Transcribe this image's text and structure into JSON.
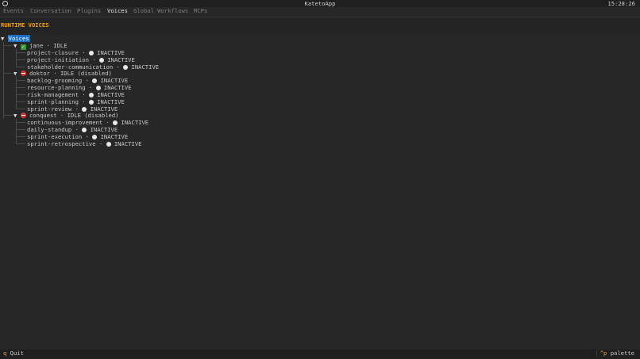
{
  "app": {
    "title": "KatetoApp",
    "clock": "15:28:26"
  },
  "tabs": [
    {
      "label": "Events"
    },
    {
      "label": "Conversation"
    },
    {
      "label": "Plugins"
    },
    {
      "label": "Voices"
    },
    {
      "label": "Global Workflows"
    },
    {
      "label": "MCPs"
    }
  ],
  "active_tab": "Voices",
  "section": {
    "title": "RUNTIME VOICES"
  },
  "tree": {
    "caret": "▼",
    "root": "Voices",
    "separator": " · ",
    "voices": [
      {
        "name": "jane",
        "status": "IDLE",
        "status_icon": "check-icon",
        "workflows": [
          {
            "name": "project-closure",
            "state": "INACTIVE"
          },
          {
            "name": "project-initiation",
            "state": "INACTIVE"
          },
          {
            "name": "stakeholder-communication",
            "state": "INACTIVE"
          }
        ]
      },
      {
        "name": "doktor",
        "status": "IDLE (disabled)",
        "status_icon": "no-entry-icon",
        "workflows": [
          {
            "name": "backlog-grooming",
            "state": "INACTIVE"
          },
          {
            "name": "resource-planning",
            "state": "INACTIVE"
          },
          {
            "name": "risk-management",
            "state": "INACTIVE"
          },
          {
            "name": "sprint-planning",
            "state": "INACTIVE"
          },
          {
            "name": "sprint-review",
            "state": "INACTIVE"
          }
        ]
      },
      {
        "name": "conquest",
        "status": "IDLE (disabled)",
        "status_icon": "no-entry-icon",
        "workflows": [
          {
            "name": "continuous-improvement",
            "state": "INACTIVE"
          },
          {
            "name": "daily-standup",
            "state": "INACTIVE"
          },
          {
            "name": "sprint-execution",
            "state": "INACTIVE"
          },
          {
            "name": "sprint-retrospective",
            "state": "INACTIVE"
          }
        ]
      }
    ]
  },
  "footer": {
    "quit_key": "q",
    "quit_label": "Quit",
    "palette_key": "^p",
    "palette_label": "palette"
  },
  "colors": {
    "accent": "#f0a020",
    "selection": "#1e6fc2",
    "active_tab_underline": "#4aa3df",
    "ok": "#3a9a3a",
    "disabled": "#d03838",
    "background": "#272727"
  }
}
